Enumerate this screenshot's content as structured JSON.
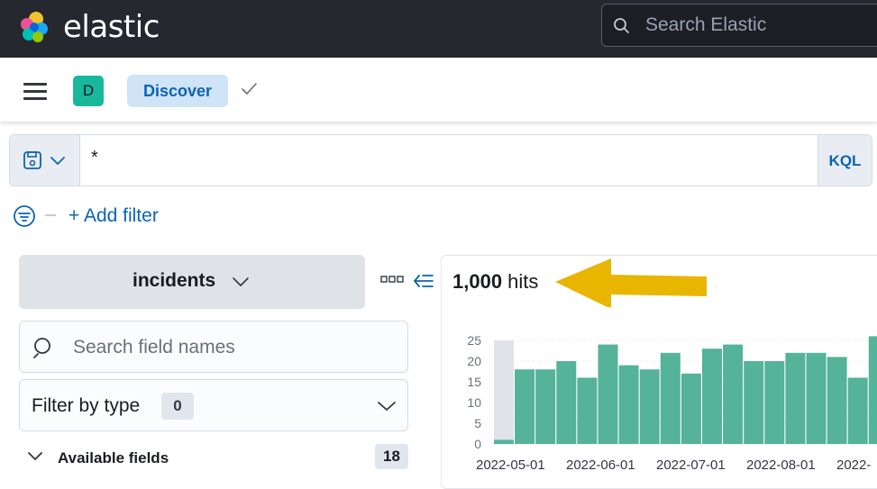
{
  "header": {
    "brand": "elastic",
    "search_placeholder": "Search Elastic"
  },
  "nav": {
    "space_initial": "D",
    "breadcrumb": "Discover"
  },
  "query": {
    "value": "*",
    "language": "KQL"
  },
  "filters": {
    "add_label": "+ Add filter"
  },
  "sidebar": {
    "index_pattern": "incidents",
    "search_placeholder": "Search field names",
    "filter_by_type_label": "Filter by type",
    "filter_by_type_count": "0",
    "available_fields_label": "Available fields",
    "available_fields_count": "18"
  },
  "results": {
    "hits_count": "1,000",
    "hits_label": " hits"
  },
  "colors": {
    "bar": "#54b399",
    "highlight_bar": "#e0e3e8",
    "arrow": "#e8b600"
  },
  "chart_data": {
    "type": "bar",
    "y_ticks": [
      "25",
      "20",
      "15",
      "10",
      "5",
      "0"
    ],
    "x_ticks": [
      "2022-05-01",
      "2022-06-01",
      "2022-07-01",
      "2022-08-01",
      "2022-"
    ],
    "ylim": [
      0,
      25
    ],
    "values": [
      1,
      18,
      18,
      20,
      16,
      24,
      19,
      18,
      22,
      17,
      23,
      24,
      20,
      20,
      22,
      22,
      21,
      16,
      26
    ]
  }
}
